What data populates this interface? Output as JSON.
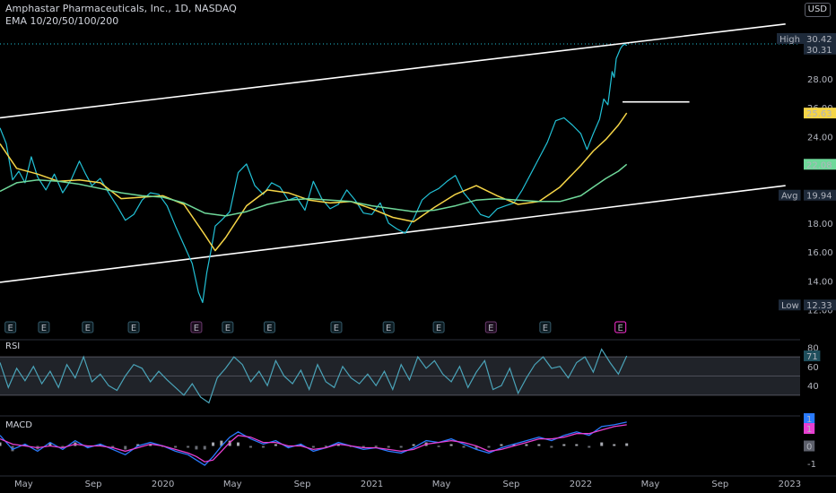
{
  "header": {
    "title": "Amphastar Pharmaceuticals, Inc., 1D, NASDAQ",
    "indicator": "EMA 10/20/50/100/200",
    "currency": "USD"
  },
  "price_labels": {
    "high_tag": "High",
    "high_value": "30.42",
    "last_value": "30.31",
    "ema20_value": "25.63",
    "ema50_value": "22.08",
    "avg_tag": "Avg",
    "avg_value": "19.94",
    "low_tag": "Low",
    "low_value": "12.33"
  },
  "earnings_marker": "E",
  "colors": {
    "price_line": "#22c1d6",
    "ema_short": "#f5d547",
    "ema_long": "#6fd89a",
    "trend_line": "#ffffff",
    "rsi_line": "#4aa3b8",
    "rsi_band": "#3a3f4a",
    "macd_line": "#2a7bff",
    "signal_line": "#e83fd1",
    "earnings_pill": "#355a6a",
    "earnings_pill_neg": "#6b3a6e",
    "earnings_pill_last": "#ff2fd6"
  },
  "chart_data": [
    {
      "type": "line",
      "pane": "price",
      "title": "Amphastar Pharmaceuticals, Inc., 1D, NASDAQ",
      "ylim": [
        11.6,
        31.6
      ],
      "yticks": [
        "12.00",
        "14.00",
        "16.00",
        "18.00",
        "20.00",
        "22.00",
        "24.00",
        "26.00",
        "28.00",
        "30.00"
      ],
      "xlim": [
        2019.22,
        2023.05
      ],
      "xticks": [
        {
          "x": 2019.333,
          "label": "May"
        },
        {
          "x": 2019.667,
          "label": "Sep"
        },
        {
          "x": 2020.0,
          "label": "2020"
        },
        {
          "x": 2020.333,
          "label": "May"
        },
        {
          "x": 2020.667,
          "label": "Sep"
        },
        {
          "x": 2021.0,
          "label": "2021"
        },
        {
          "x": 2021.333,
          "label": "May"
        },
        {
          "x": 2021.667,
          "label": "Sep"
        },
        {
          "x": 2022.0,
          "label": "2022"
        },
        {
          "x": 2022.333,
          "label": "May"
        },
        {
          "x": 2022.667,
          "label": "Sep"
        },
        {
          "x": 2023.0,
          "label": "2023"
        }
      ],
      "series": [
        {
          "role": "price",
          "x": [
            2019.22,
            2019.25,
            2019.28,
            2019.31,
            2019.34,
            2019.37,
            2019.4,
            2019.44,
            2019.48,
            2019.52,
            2019.56,
            2019.6,
            2019.63,
            2019.66,
            2019.7,
            2019.74,
            2019.78,
            2019.82,
            2019.86,
            2019.9,
            2019.94,
            2019.98,
            2020.02,
            2020.06,
            2020.1,
            2020.14,
            2020.17,
            2020.19,
            2020.21,
            2020.23,
            2020.25,
            2020.28,
            2020.32,
            2020.36,
            2020.4,
            2020.44,
            2020.48,
            2020.52,
            2020.56,
            2020.6,
            2020.64,
            2020.68,
            2020.72,
            2020.76,
            2020.8,
            2020.84,
            2020.88,
            2020.92,
            2020.96,
            2021.0,
            2021.04,
            2021.08,
            2021.12,
            2021.16,
            2021.2,
            2021.24,
            2021.28,
            2021.32,
            2021.36,
            2021.4,
            2021.44,
            2021.48,
            2021.52,
            2021.56,
            2021.6,
            2021.64,
            2021.68,
            2021.72,
            2021.76,
            2021.8,
            2021.84,
            2021.88,
            2021.92,
            2021.96,
            2022.0,
            2022.03,
            2022.06,
            2022.09,
            2022.11,
            2022.13,
            2022.15,
            2022.16,
            2022.17,
            2022.19,
            2022.2,
            2022.21,
            2022.22
          ],
          "y": [
            24.6,
            23.5,
            21.0,
            21.6,
            20.8,
            22.6,
            21.2,
            20.3,
            21.4,
            20.1,
            21.0,
            22.3,
            21.4,
            20.6,
            21.1,
            20.1,
            19.2,
            18.2,
            18.6,
            19.6,
            20.1,
            20.0,
            19.2,
            17.8,
            16.5,
            15.2,
            13.2,
            12.5,
            14.6,
            16.1,
            17.8,
            18.2,
            18.8,
            21.5,
            22.1,
            20.6,
            20.0,
            20.8,
            20.5,
            19.6,
            19.8,
            18.9,
            20.9,
            19.7,
            19.0,
            19.3,
            20.3,
            19.6,
            18.7,
            18.6,
            19.4,
            18.0,
            17.6,
            17.3,
            18.3,
            19.6,
            20.1,
            20.4,
            20.9,
            21.3,
            20.1,
            19.4,
            18.6,
            18.4,
            19.0,
            19.2,
            19.4,
            20.3,
            21.4,
            22.5,
            23.6,
            25.1,
            25.3,
            24.8,
            24.2,
            23.1,
            24.2,
            25.2,
            26.6,
            26.2,
            28.5,
            28.1,
            29.4,
            30.1,
            30.3,
            30.4,
            30.31
          ]
        },
        {
          "role": "ema_short",
          "x": [
            2019.22,
            2019.3,
            2019.4,
            2019.5,
            2019.6,
            2019.7,
            2019.8,
            2019.9,
            2020.0,
            2020.1,
            2020.2,
            2020.25,
            2020.3,
            2020.4,
            2020.5,
            2020.6,
            2020.7,
            2020.8,
            2020.9,
            2021.0,
            2021.1,
            2021.2,
            2021.3,
            2021.4,
            2021.5,
            2021.6,
            2021.7,
            2021.8,
            2021.9,
            2022.0,
            2022.06,
            2022.12,
            2022.18,
            2022.22
          ],
          "y": [
            23.5,
            21.8,
            21.4,
            20.9,
            21.0,
            20.8,
            19.7,
            19.8,
            19.9,
            19.3,
            17.2,
            16.1,
            17.0,
            19.2,
            20.3,
            20.1,
            19.6,
            19.4,
            19.5,
            19.0,
            18.4,
            18.1,
            19.1,
            20.0,
            20.6,
            19.9,
            19.3,
            19.5,
            20.5,
            22.0,
            23.0,
            23.8,
            24.8,
            25.63
          ]
        },
        {
          "role": "ema_long",
          "x": [
            2019.22,
            2019.3,
            2019.4,
            2019.5,
            2019.6,
            2019.7,
            2019.8,
            2019.9,
            2020.0,
            2020.1,
            2020.2,
            2020.3,
            2020.4,
            2020.5,
            2020.6,
            2020.7,
            2020.8,
            2020.9,
            2021.0,
            2021.1,
            2021.2,
            2021.3,
            2021.4,
            2021.5,
            2021.6,
            2021.7,
            2021.8,
            2021.9,
            2022.0,
            2022.06,
            2022.12,
            2022.18,
            2022.22
          ],
          "y": [
            20.2,
            20.8,
            21.0,
            20.9,
            20.7,
            20.4,
            20.1,
            19.9,
            19.8,
            19.4,
            18.7,
            18.5,
            18.8,
            19.3,
            19.6,
            19.7,
            19.6,
            19.5,
            19.2,
            19.0,
            18.8,
            18.9,
            19.2,
            19.6,
            19.7,
            19.6,
            19.5,
            19.5,
            19.9,
            20.5,
            21.1,
            21.6,
            22.08
          ]
        }
      ],
      "trend_lines": [
        {
          "x": [
            2019.22,
            2022.98
          ],
          "y": [
            25.3,
            31.8
          ]
        },
        {
          "x": [
            2019.22,
            2022.98
          ],
          "y": [
            13.9,
            20.6
          ]
        },
        {
          "x": [
            2022.2,
            2022.52
          ],
          "y": [
            26.4,
            26.4
          ]
        }
      ],
      "earnings": [
        {
          "x": 2019.27,
          "style": "normal"
        },
        {
          "x": 2019.43,
          "style": "normal"
        },
        {
          "x": 2019.64,
          "style": "normal"
        },
        {
          "x": 2019.86,
          "style": "normal"
        },
        {
          "x": 2020.16,
          "style": "negative"
        },
        {
          "x": 2020.31,
          "style": "normal"
        },
        {
          "x": 2020.51,
          "style": "normal"
        },
        {
          "x": 2020.83,
          "style": "normal"
        },
        {
          "x": 2021.08,
          "style": "normal"
        },
        {
          "x": 2021.32,
          "style": "normal"
        },
        {
          "x": 2021.57,
          "style": "negative"
        },
        {
          "x": 2021.83,
          "style": "normal"
        },
        {
          "x": 2022.19,
          "style": "last"
        }
      ]
    },
    {
      "type": "line",
      "pane": "rsi",
      "title": "RSI",
      "ylim": [
        14,
        86
      ],
      "yticks": [
        40,
        60,
        80
      ],
      "band": [
        30,
        70
      ],
      "midline": 50,
      "last_value": "71",
      "series": [
        {
          "role": "rsi",
          "x": [
            2019.22,
            2019.26,
            2019.3,
            2019.34,
            2019.38,
            2019.42,
            2019.46,
            2019.5,
            2019.54,
            2019.58,
            2019.62,
            2019.66,
            2019.7,
            2019.74,
            2019.78,
            2019.82,
            2019.86,
            2019.9,
            2019.94,
            2019.98,
            2020.02,
            2020.06,
            2020.1,
            2020.14,
            2020.18,
            2020.22,
            2020.26,
            2020.3,
            2020.34,
            2020.38,
            2020.42,
            2020.46,
            2020.5,
            2020.54,
            2020.58,
            2020.62,
            2020.66,
            2020.7,
            2020.74,
            2020.78,
            2020.82,
            2020.86,
            2020.9,
            2020.94,
            2020.98,
            2021.02,
            2021.06,
            2021.1,
            2021.14,
            2021.18,
            2021.22,
            2021.26,
            2021.3,
            2021.34,
            2021.38,
            2021.42,
            2021.46,
            2021.5,
            2021.54,
            2021.58,
            2021.62,
            2021.66,
            2021.7,
            2021.74,
            2021.78,
            2021.82,
            2021.86,
            2021.9,
            2021.94,
            2021.98,
            2022.02,
            2022.06,
            2022.1,
            2022.14,
            2022.18,
            2022.22
          ],
          "y": [
            64,
            38,
            58,
            45,
            60,
            42,
            55,
            38,
            62,
            48,
            70,
            44,
            52,
            40,
            35,
            50,
            62,
            58,
            44,
            55,
            46,
            38,
            30,
            42,
            28,
            22,
            48,
            58,
            70,
            62,
            44,
            55,
            40,
            66,
            50,
            42,
            56,
            36,
            62,
            44,
            38,
            60,
            48,
            42,
            52,
            40,
            55,
            36,
            62,
            46,
            70,
            58,
            66,
            52,
            44,
            60,
            38,
            54,
            66,
            36,
            40,
            58,
            32,
            48,
            62,
            70,
            58,
            60,
            48,
            64,
            70,
            54,
            78,
            64,
            52,
            71
          ]
        }
      ]
    },
    {
      "type": "line",
      "pane": "macd",
      "title": "MACD",
      "ylim": [
        -1.55,
        1.55
      ],
      "yticks": [
        -1,
        0
      ],
      "last_values": [
        "1",
        "1",
        "0"
      ],
      "series": [
        {
          "role": "macd",
          "x": [
            2019.22,
            2019.28,
            2019.34,
            2019.4,
            2019.46,
            2019.52,
            2019.58,
            2019.64,
            2019.7,
            2019.76,
            2019.82,
            2019.88,
            2019.94,
            2020.0,
            2020.06,
            2020.12,
            2020.16,
            2020.2,
            2020.24,
            2020.28,
            2020.32,
            2020.36,
            2020.42,
            2020.48,
            2020.54,
            2020.6,
            2020.66,
            2020.72,
            2020.78,
            2020.84,
            2020.9,
            2020.96,
            2021.02,
            2021.08,
            2021.14,
            2021.2,
            2021.26,
            2021.32,
            2021.38,
            2021.44,
            2021.5,
            2021.56,
            2021.62,
            2021.68,
            2021.74,
            2021.8,
            2021.86,
            2021.92,
            2021.98,
            2022.04,
            2022.1,
            2022.16,
            2022.22
          ],
          "y": [
            0.6,
            -0.2,
            0.1,
            -0.3,
            0.2,
            -0.2,
            0.3,
            -0.1,
            0.1,
            -0.2,
            -0.5,
            0.0,
            0.2,
            0.0,
            -0.3,
            -0.5,
            -0.8,
            -1.1,
            -0.6,
            0.0,
            0.5,
            0.8,
            0.4,
            0.1,
            0.3,
            -0.1,
            0.1,
            -0.3,
            -0.1,
            0.2,
            0.0,
            -0.2,
            -0.1,
            -0.3,
            -0.4,
            -0.1,
            0.3,
            0.2,
            0.4,
            0.1,
            -0.2,
            -0.4,
            -0.1,
            0.1,
            0.3,
            0.5,
            0.3,
            0.6,
            0.8,
            0.6,
            1.1,
            1.2,
            1.35
          ]
        },
        {
          "role": "signal",
          "x": [
            2019.22,
            2019.28,
            2019.34,
            2019.4,
            2019.46,
            2019.52,
            2019.58,
            2019.64,
            2019.7,
            2019.76,
            2019.82,
            2019.88,
            2019.94,
            2020.0,
            2020.06,
            2020.12,
            2020.16,
            2020.2,
            2020.24,
            2020.28,
            2020.32,
            2020.36,
            2020.42,
            2020.48,
            2020.54,
            2020.6,
            2020.66,
            2020.72,
            2020.78,
            2020.84,
            2020.9,
            2020.96,
            2021.02,
            2021.08,
            2021.14,
            2021.2,
            2021.26,
            2021.32,
            2021.38,
            2021.44,
            2021.5,
            2021.56,
            2021.62,
            2021.68,
            2021.74,
            2021.8,
            2021.86,
            2021.92,
            2021.98,
            2022.04,
            2022.1,
            2022.16,
            2022.22
          ],
          "y": [
            0.4,
            0.1,
            0.0,
            -0.1,
            0.0,
            -0.1,
            0.1,
            0.0,
            0.0,
            -0.1,
            -0.3,
            -0.1,
            0.1,
            0.0,
            -0.2,
            -0.4,
            -0.6,
            -0.9,
            -0.8,
            -0.3,
            0.2,
            0.6,
            0.5,
            0.2,
            0.2,
            0.0,
            0.0,
            -0.2,
            -0.1,
            0.1,
            0.0,
            -0.1,
            -0.1,
            -0.2,
            -0.3,
            -0.2,
            0.1,
            0.2,
            0.3,
            0.2,
            0.0,
            -0.3,
            -0.2,
            0.0,
            0.2,
            0.4,
            0.4,
            0.5,
            0.7,
            0.7,
            0.9,
            1.1,
            1.2
          ]
        }
      ]
    }
  ]
}
